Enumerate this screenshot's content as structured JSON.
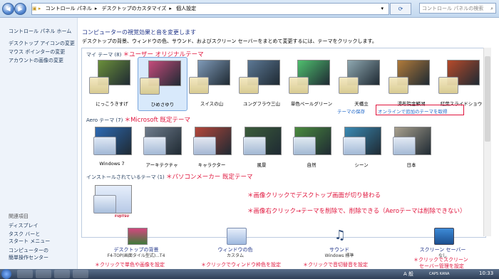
{
  "address": {
    "breadcrumbs": [
      "コントロール パネル",
      "デスクトップのカスタマイズ",
      "個人設定"
    ],
    "search_placeholder": "コントロール パネルの検索"
  },
  "sidebar": {
    "home": "コントロール パネル ホーム",
    "links": [
      "デスクトップ アイコンの変更",
      "マウス ポインターの変更",
      "アカウントの画像の変更"
    ],
    "related_header": "関連項目",
    "related": [
      "ディスプレイ",
      "タスク バーと",
      "スタート メニュー",
      "コンピューターの",
      "簡単操作センター"
    ]
  },
  "main": {
    "heading": "コンピューターの視覚効果と音を変更します",
    "description": "デスクトップの背景、ウィンドウの色、サウンド、およびスクリーン セーバーをまとめて変更するには、テーマをクリックします。",
    "my_themes": {
      "label": "マイ テーマ (8)",
      "note": "＊ユーザー オリジナルテーマ",
      "items": [
        {
          "name": "にっこうきすげ",
          "color": "#6b8f3a"
        },
        {
          "name": "ひめさゆり",
          "color": "#c44a7a",
          "selected": true
        },
        {
          "name": "スイスの山",
          "color": "#7f9ab8"
        },
        {
          "name": "ユングフラウ三山",
          "color": "#5c7894"
        },
        {
          "name": "単色ペールグリーン",
          "color": "#4fbf6e"
        },
        {
          "name": "天橋立",
          "color": "#8ea7b0"
        },
        {
          "name": "湯布院金鱗湖",
          "color": "#b07a3a"
        },
        {
          "name": "紅葉スライドショウ",
          "color": "#b64a2a"
        }
      ],
      "save_link": "テーマの保存",
      "online_link": "オンラインで追加のテーマを取得"
    },
    "aero_themes": {
      "label": "Aero テーマ (7)",
      "note": "＊Microsoft 既定テーマ",
      "items": [
        {
          "name": "Windows 7",
          "color": "#2d6ab4"
        },
        {
          "name": "アーキテクチャ",
          "color": "#6f7c8c"
        },
        {
          "name": "キャラクター",
          "color": "#b4463a"
        },
        {
          "name": "風景",
          "color": "#3b5c3a"
        },
        {
          "name": "自然",
          "color": "#4a8a3e"
        },
        {
          "name": "シーン",
          "color": "#3a8ab4"
        },
        {
          "name": "日本",
          "color": "#a8a08e"
        }
      ]
    },
    "installed_themes": {
      "label": "インストールされているテーマ (1)",
      "note": "＊パソコンメーカー 既定テーマ",
      "brand": "FUJITSU"
    },
    "notes": [
      "＊画像クリックでデスクトップ画面が切り替わる",
      "＊画像右クリック→テーマを削除で、削除できる（Aeroテーマは削除できない）"
    ]
  },
  "bottom": [
    {
      "label": "デスクトップの背景",
      "sub": "F4-TOP(画面タイル型式)...T4"
    },
    {
      "label": "ウィンドウの色",
      "sub": "カスタム"
    },
    {
      "label": "サウンド",
      "sub": "Windows 標準"
    },
    {
      "label": "スクリーン セーバー",
      "sub": "なし"
    }
  ],
  "captions": [
    "＊クリックで単色や画像を設定",
    "＊クリックでウィンドウ枠色を設定",
    "＊クリックで音切替音を設定",
    "＊クリックでスクリーン",
    "セーバー管理を設定"
  ],
  "taskbar": {
    "ime": "A 般",
    "caps": "CAPS KANA",
    "time": "10:33"
  }
}
